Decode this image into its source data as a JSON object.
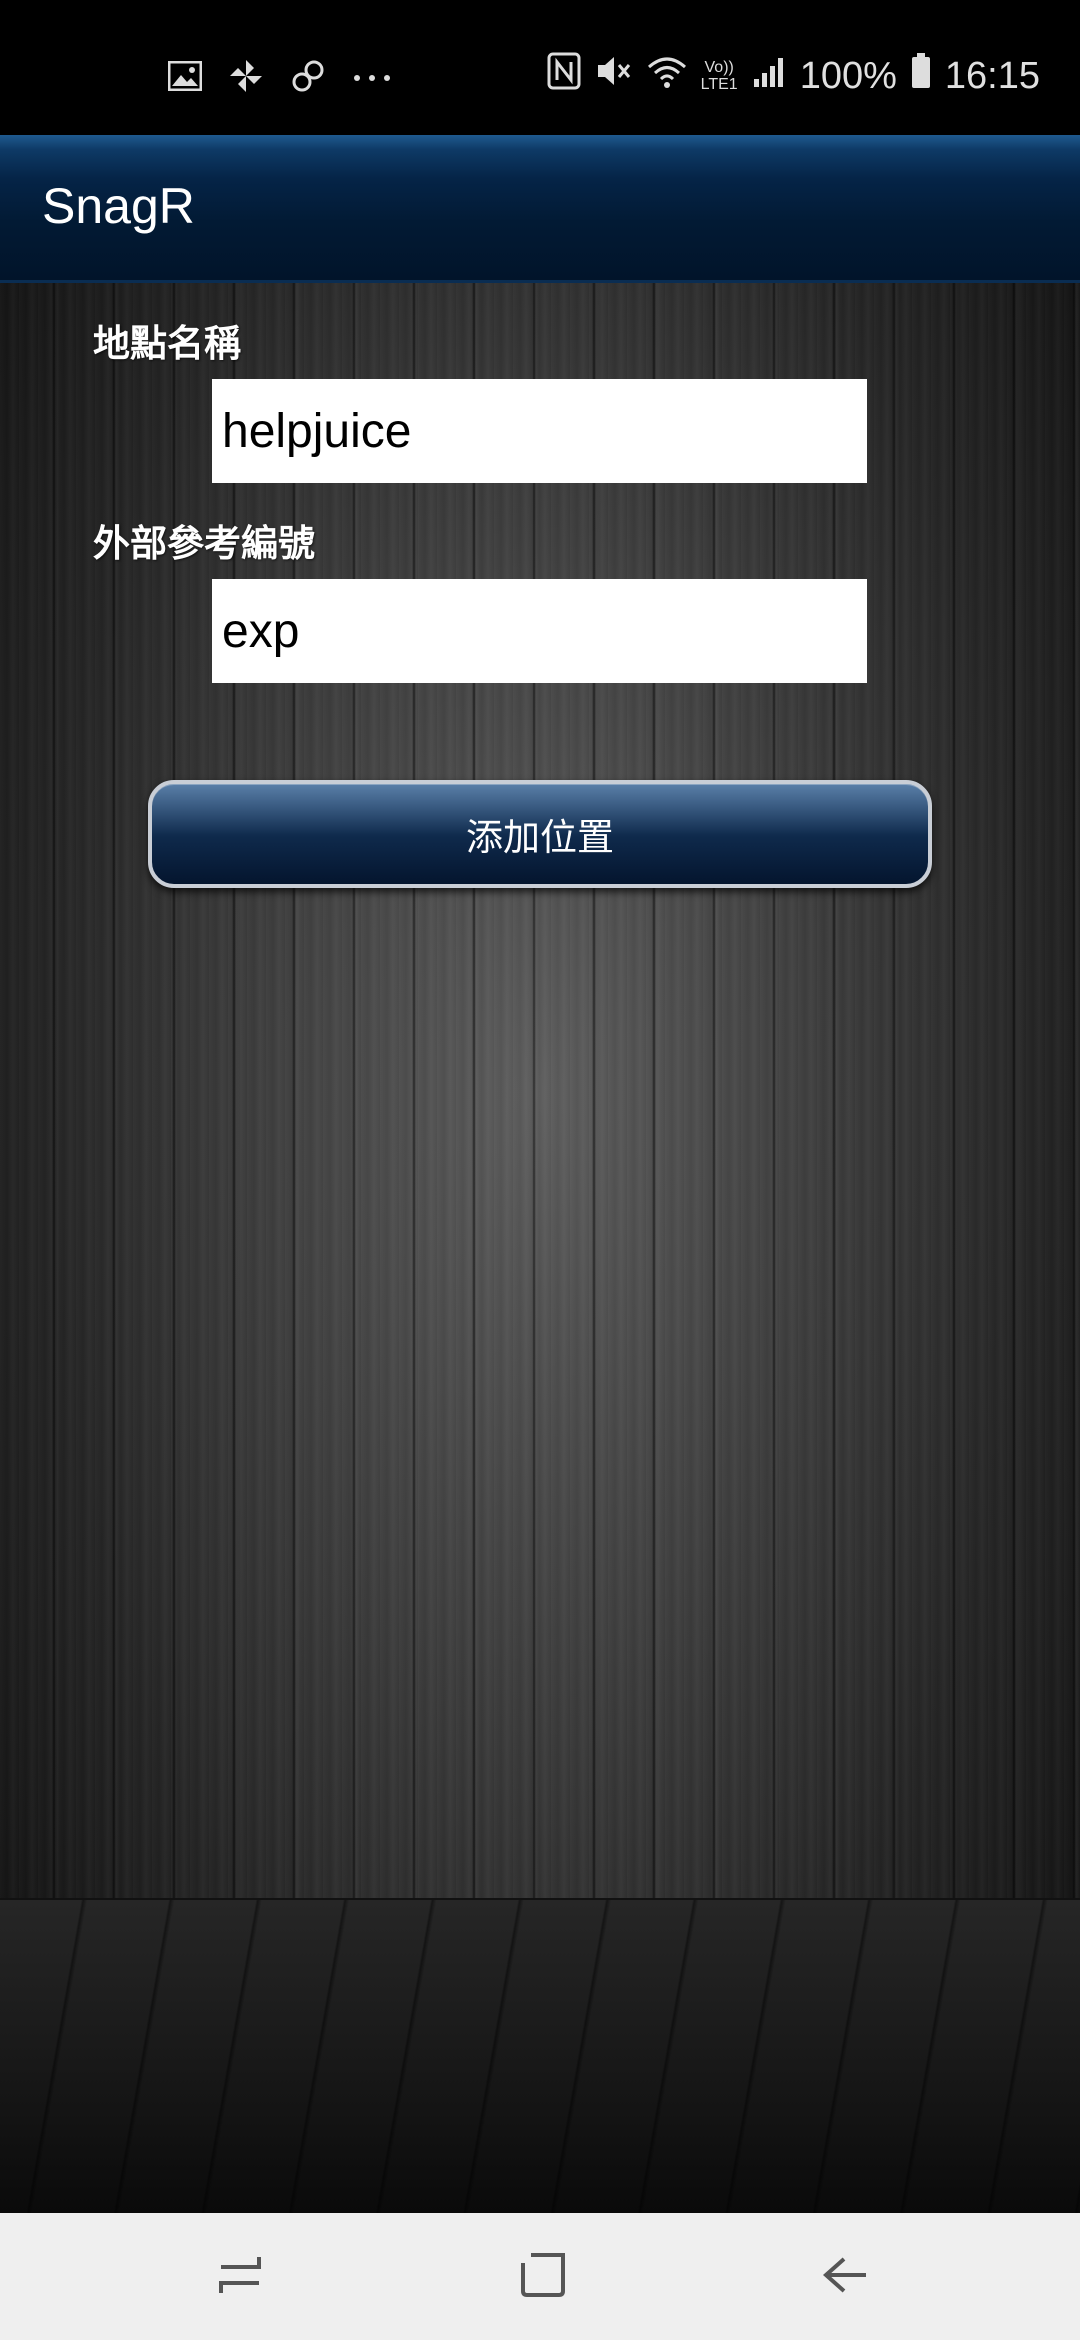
{
  "status_bar": {
    "battery_percent": "100%",
    "time": "16:15",
    "left_icons": [
      "image-icon",
      "pinwheel-icon",
      "link-icon",
      "more-dots-icon"
    ],
    "right_icons": [
      "nfc-icon",
      "mute-icon",
      "wifi-icon",
      "volte-icon",
      "signal-icon",
      "battery-icon"
    ],
    "volte_label_top": "Vo))",
    "volte_label_bottom": "LTE1"
  },
  "app_bar": {
    "title": "SnagR"
  },
  "form": {
    "location_name_label": "地點名稱",
    "location_name_value": "helpjuice",
    "external_ref_label": "外部參考編號",
    "external_ref_value": "exp",
    "add_button_label": "添加位置"
  },
  "nav_bar": {
    "buttons": [
      "recent-apps-icon",
      "home-icon",
      "back-icon"
    ]
  },
  "colors": {
    "app_bar": "#021a34",
    "button_top": "#5a7fa8",
    "button_bottom": "#04152e",
    "nav_bar": "#efefef"
  }
}
